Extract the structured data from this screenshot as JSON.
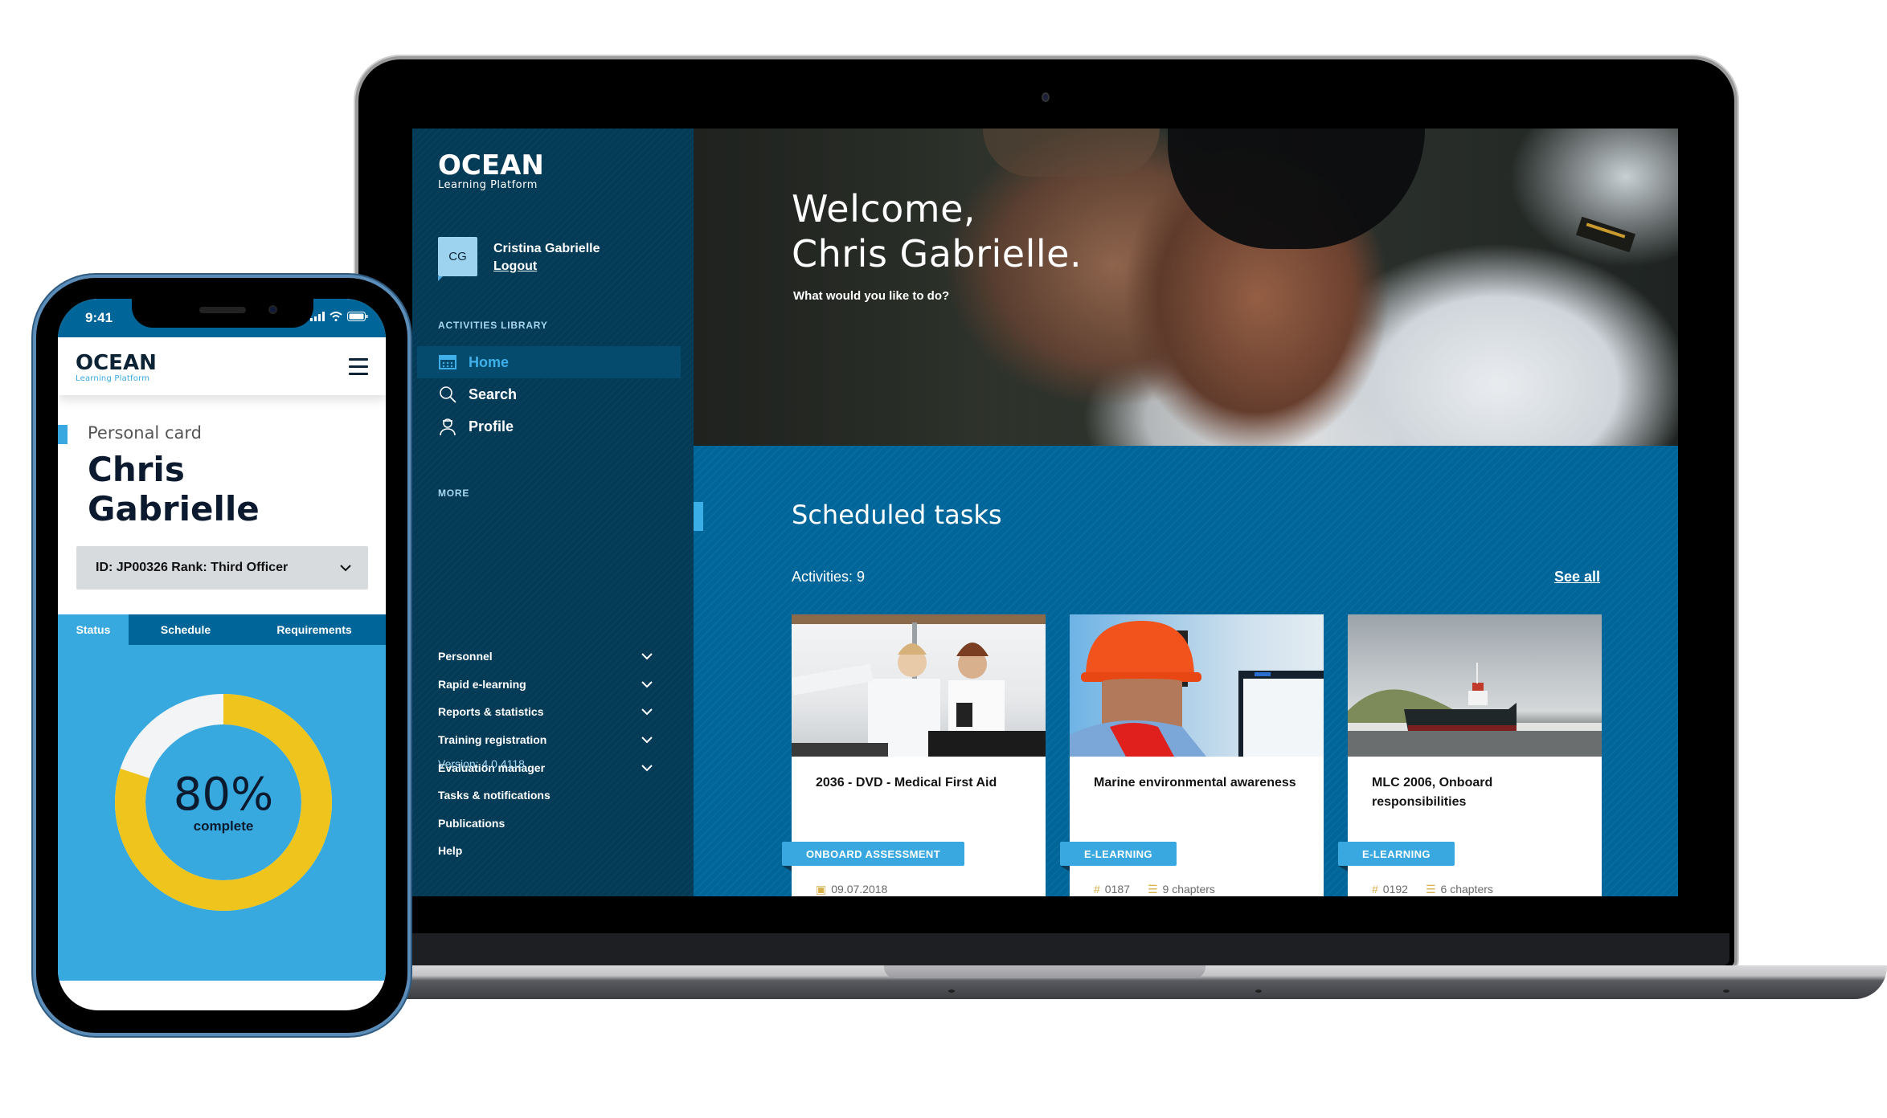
{
  "colors": {
    "sidebar_bg": "#033a56",
    "primary_blue": "#00669a",
    "accent_blue": "#3aa8e0",
    "donut_fill": "#eec41d",
    "donut_track": "#f2f4f6",
    "meta_icon": "#d6b04a"
  },
  "laptop": {
    "brand": {
      "name": "OCEAN",
      "tagline": "Learning Platform"
    },
    "user": {
      "initials": "CG",
      "name": "Cristina Gabrielle",
      "logout_label": "Logout"
    },
    "activities_library": {
      "heading": "ACTIVITIES LIBRARY",
      "items": [
        {
          "label": "Home",
          "icon": "home-icon",
          "active": true
        },
        {
          "label": "Search",
          "icon": "search-icon",
          "active": false
        },
        {
          "label": "Profile",
          "icon": "profile-icon",
          "active": false
        }
      ]
    },
    "more": {
      "heading": "MORE",
      "items": [
        {
          "label": "Personnel",
          "expandable": true
        },
        {
          "label": "Rapid e-learning",
          "expandable": true
        },
        {
          "label": "Reports & statistics",
          "expandable": true
        },
        {
          "label": "Training registration",
          "expandable": true
        },
        {
          "label": "Evaluation manager",
          "expandable": true
        },
        {
          "label": "Tasks & notifications",
          "expandable": false
        },
        {
          "label": "Publications",
          "expandable": false
        },
        {
          "label": "Help",
          "expandable": false
        }
      ]
    },
    "version": "Version: 4.0.4118",
    "hero": {
      "title_line1": "Welcome,",
      "title_line2": "Chris Gabrielle.",
      "subtitle": "What would you like to do?"
    },
    "scheduled": {
      "title": "Scheduled tasks",
      "activities_count": "Activities: 9",
      "see_all_label": "See all",
      "cards": [
        {
          "title": "2036 - DVD - Medical First Aid",
          "badge": "ONBOARD ASSESSMENT",
          "meta": [
            {
              "icon": "calendar-icon",
              "glyph": "▣",
              "text": "09.07.2018"
            }
          ]
        },
        {
          "title": "Marine environmental awareness",
          "badge": "E-LEARNING",
          "meta": [
            {
              "icon": "hash-icon",
              "glyph": "#",
              "text": "0187"
            },
            {
              "icon": "list-icon",
              "glyph": "☰",
              "text": "9 chapters"
            }
          ]
        },
        {
          "title": "MLC 2006, Onboard responsibilities",
          "badge": "E-LEARNING",
          "meta": [
            {
              "icon": "hash-icon",
              "glyph": "#",
              "text": "0192"
            },
            {
              "icon": "list-icon",
              "glyph": "☰",
              "text": "6 chapters"
            }
          ]
        }
      ]
    }
  },
  "phone": {
    "status_time": "9:41",
    "brand": {
      "name": "OCEAN",
      "tagline": "Learning Platform"
    },
    "personal_card": {
      "label": "Personal card",
      "name_line1": "Chris",
      "name_line2": "Gabrielle",
      "selector_value": "ID: JP00326 Rank: Third Officer"
    },
    "tabs": [
      {
        "label": "Status",
        "active": true
      },
      {
        "label": "Schedule",
        "active": false
      },
      {
        "label": "Requirements",
        "active": false
      }
    ],
    "progress": {
      "percent": 80,
      "percent_label": "80%",
      "caption": "complete"
    }
  }
}
